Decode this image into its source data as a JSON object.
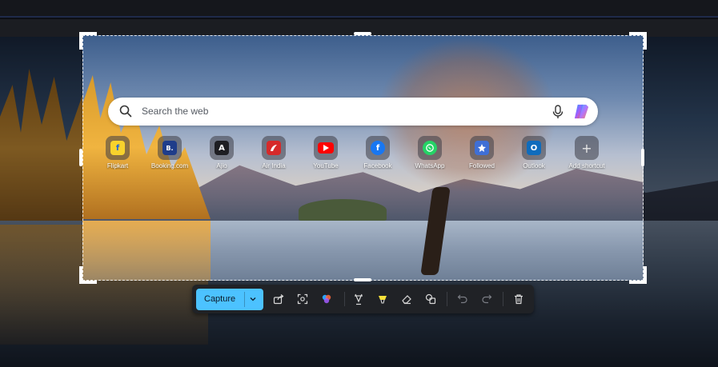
{
  "search": {
    "placeholder": "Search the web"
  },
  "shortcuts": [
    {
      "label": "Flipkart",
      "icon": "flipkart-icon",
      "color": "#f8d22c",
      "glyph": "f"
    },
    {
      "label": "Booking.com",
      "icon": "booking-icon",
      "color": "#1f3d8a",
      "glyph": "B."
    },
    {
      "label": "Ajio",
      "icon": "ajio-icon",
      "color": "#1e1e22",
      "glyph": "A"
    },
    {
      "label": "Air India",
      "icon": "air-india-icon",
      "color": "#d62a2a",
      "glyph": ""
    },
    {
      "label": "YouTube",
      "icon": "youtube-icon",
      "color": "#ff0000",
      "glyph": ""
    },
    {
      "label": "Facebook",
      "icon": "facebook-icon",
      "color": "#1877f2",
      "glyph": "f"
    },
    {
      "label": "WhatsApp",
      "icon": "whatsapp-icon",
      "color": "#25d366",
      "glyph": ""
    },
    {
      "label": "Followed",
      "icon": "followed-icon",
      "color": "#3f6fd6",
      "glyph": ""
    },
    {
      "label": "Outlook",
      "icon": "outlook-icon",
      "color": "#0f6cbd",
      "glyph": "O"
    },
    {
      "label": "Add shortcut",
      "icon": "plus-icon",
      "color": "#5a5d66",
      "glyph": "+"
    }
  ],
  "toolbar": {
    "capture_label": "Capture",
    "accent": "#4cc2ff"
  }
}
